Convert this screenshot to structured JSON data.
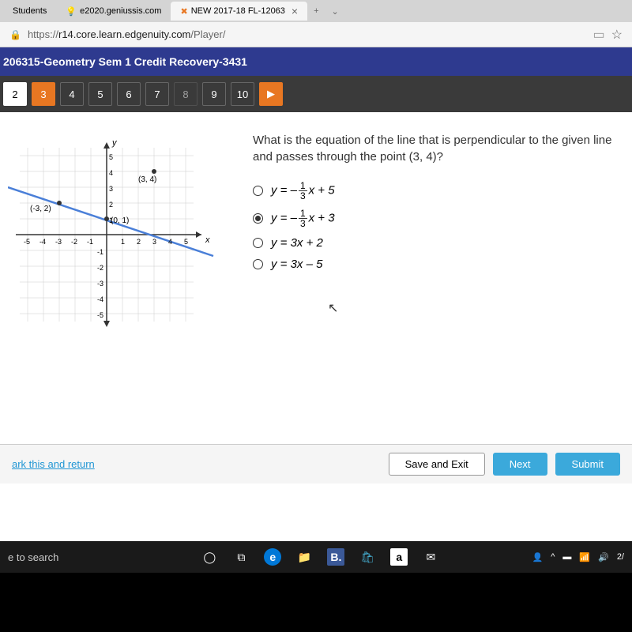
{
  "tabs": {
    "tab1": "Students",
    "tab2": "e2020.geniussis.com",
    "tab3": "NEW 2017-18 FL-12063"
  },
  "url": {
    "prefix": "https://",
    "host": "r14.core.learn.edgenuity.com",
    "path": "/Player/"
  },
  "course_title": "206315-Geometry Sem 1 Credit Recovery-3431",
  "nav": [
    "2",
    "3",
    "4",
    "5",
    "6",
    "7",
    "8",
    "9",
    "10"
  ],
  "graph": {
    "y_label": "y",
    "x_label": "x",
    "pt1": "(-3, 2)",
    "pt2": "(0, 1)",
    "pt3": "(3, 4)"
  },
  "question": "What is the equation of the line that is perpendicular to the given line and passes through the point (3, 4)?",
  "answers": {
    "a": {
      "prefix": "y = –",
      "num": "1",
      "den": "3",
      "suffix": "x + 5"
    },
    "b": {
      "prefix": "y = –",
      "num": "1",
      "den": "3",
      "suffix": "x + 3"
    },
    "c": "y = 3x + 2",
    "d": "y = 3x – 5"
  },
  "mark_link": "ark this and return",
  "buttons": {
    "save": "Save and Exit",
    "next": "Next",
    "submit": "Submit"
  },
  "taskbar": {
    "search": "e to search",
    "time": "2/"
  }
}
